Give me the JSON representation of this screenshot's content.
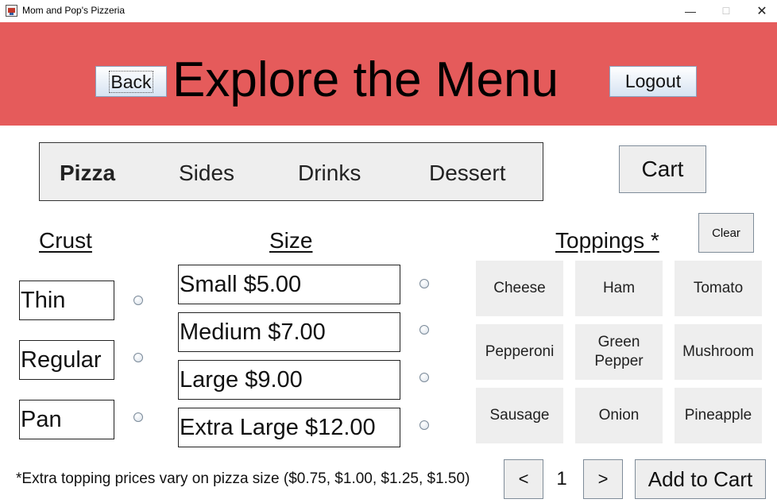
{
  "window": {
    "title": "Mom and Pop's Pizzeria",
    "controls": {
      "minimize": "—",
      "maximize": "☐",
      "close": "✕"
    },
    "icon": "pizzeria-app-icon"
  },
  "header": {
    "title": "Explore the Menu",
    "back_label": "Back",
    "logout_label": "Logout",
    "background_color": "#e55b5b"
  },
  "tabs": {
    "items": [
      "Pizza",
      "Sides",
      "Drinks",
      "Dessert"
    ],
    "active": "Pizza"
  },
  "cart_label": "Cart",
  "clear_label": "Clear",
  "sections": {
    "crust": "Crust",
    "size": "Size",
    "toppings": "Toppings *"
  },
  "crust_options": [
    "Thin",
    "Regular",
    "Pan"
  ],
  "size_options": [
    "Small $5.00",
    "Medium $7.00",
    "Large $9.00",
    "Extra Large $12.00"
  ],
  "toppings": [
    [
      "Cheese",
      "Ham",
      "Tomato"
    ],
    [
      "Pepperoni",
      "Green Pepper",
      "Mushroom"
    ],
    [
      "Sausage",
      "Onion",
      "Pineapple"
    ]
  ],
  "footer_note": "*Extra topping prices vary on pizza size ($0.75, $1.00, $1.25, $1.50)",
  "quantity": {
    "prev_label": "<",
    "value": "1",
    "next_label": ">"
  },
  "add_to_cart_label": "Add to Cart"
}
